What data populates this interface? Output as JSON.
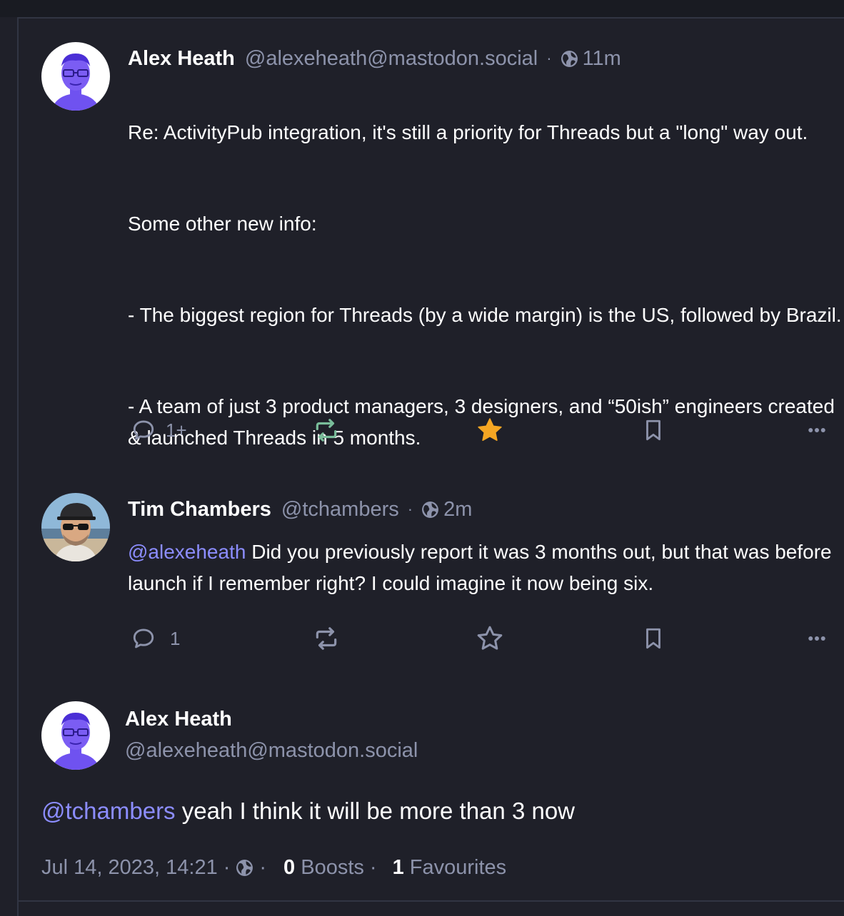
{
  "statuses": [
    {
      "display_name": "Alex Heath",
      "acct": "@alexeheath@mastodon.social",
      "separator": "·",
      "visibility_icon": "globe-icon",
      "time": "11m",
      "content_paragraphs": [
        "Re: ActivityPub integration, it's still a priority for Threads but a \"long\" way out.",
        "Some other new info:",
        "- The biggest region for Threads (by a wide margin) is the US, followed by Brazil.",
        "- A team of just 3 product managers, 3 designers, and “50ish” engineers created & launched Threads in 5 months."
      ],
      "actions": {
        "reply_count": "1+",
        "boosted": true,
        "favourited": true
      }
    },
    {
      "display_name": "Tim Chambers",
      "acct": "@tchambers",
      "separator": "·",
      "visibility_icon": "globe-icon",
      "time": "2m",
      "mention": "@alexeheath",
      "content": " Did you previously report it was 3 months out, but that was before launch if I remember right? I could imagine it now being six.",
      "actions": {
        "reply_count": "1",
        "boosted": false,
        "favourited": false
      }
    }
  ],
  "detailed_status": {
    "display_name": "Alex Heath",
    "acct": "@alexeheath@mastodon.social",
    "mention": "@tchambers",
    "content": " yeah I think it will be more than 3 now",
    "timestamp": "Jul 14, 2023, 14:21",
    "separator": "·",
    "boosts_count": "0",
    "boosts_label": "Boosts",
    "favourites_count": "1",
    "favourites_label": "Favourites"
  },
  "colors": {
    "background": "#1f2029",
    "text": "#ffffff",
    "muted": "#8d93ab",
    "mention": "#8c8dff",
    "boost_active": "#79bd9a",
    "favourite_active": "#ca8f04",
    "star_fill": "#f5a623"
  }
}
